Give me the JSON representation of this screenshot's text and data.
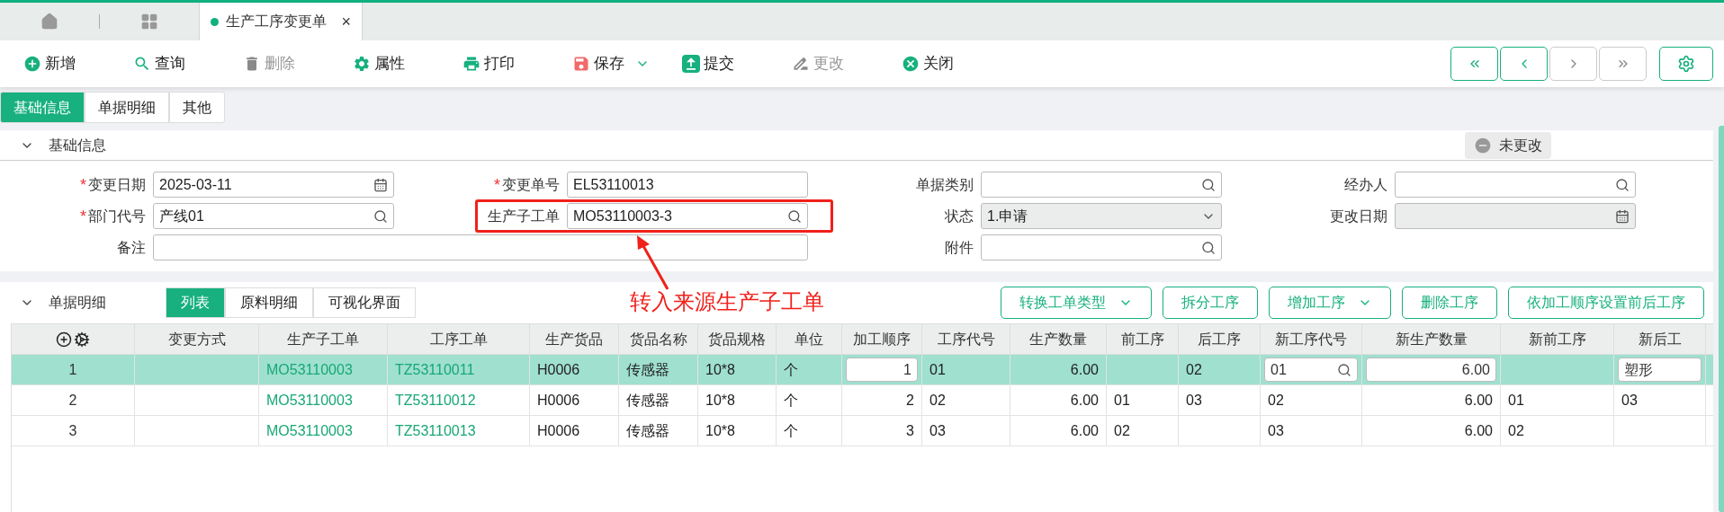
{
  "tab_bar": {
    "tabs": [
      {
        "label": "生产工序变更单",
        "selected": true,
        "close": "×"
      }
    ]
  },
  "toolbar": {
    "items": [
      {
        "label": "新增",
        "kind": "add",
        "disabled": false,
        "has_menu": false
      },
      {
        "label": "查询",
        "kind": "search",
        "disabled": false,
        "has_menu": false
      },
      {
        "label": "删除",
        "kind": "delete",
        "disabled": true,
        "has_menu": false
      },
      {
        "label": "属性",
        "kind": "settings",
        "disabled": false,
        "has_menu": false
      },
      {
        "label": "打印",
        "kind": "print",
        "disabled": false,
        "has_menu": false
      },
      {
        "label": "保存",
        "kind": "save",
        "disabled": false,
        "has_menu": true
      },
      {
        "label": "提交",
        "kind": "submit",
        "disabled": false,
        "has_menu": false
      },
      {
        "label": "更改",
        "kind": "edit",
        "disabled": true,
        "has_menu": false
      },
      {
        "label": "关闭",
        "kind": "close",
        "disabled": false,
        "has_menu": false
      }
    ],
    "nav": [
      {
        "kind": "first",
        "disabled": false
      },
      {
        "kind": "prev",
        "disabled": false
      },
      {
        "kind": "next",
        "disabled": true
      },
      {
        "kind": "last",
        "disabled": true
      }
    ]
  },
  "page_tabs": [
    {
      "label": "基础信息",
      "selected": true
    },
    {
      "label": "单据明细",
      "selected": false
    },
    {
      "label": "其他",
      "selected": false
    }
  ],
  "basic_section": {
    "title": "基础信息",
    "expanded": true,
    "status_badge": "未更改",
    "fields": [
      {
        "label": "变更日期",
        "marker": "*",
        "value": "2025-03-11",
        "kind": "date",
        "disabled": false,
        "highlighted": false,
        "wide": false
      },
      {
        "label": "变更单号",
        "marker": "*",
        "value": "EL53110013",
        "kind": "text",
        "disabled": false,
        "highlighted": false,
        "wide": false
      },
      {
        "label": "单据类别",
        "kind": "lookup",
        "disabled": false,
        "highlighted": false,
        "wide": false
      },
      {
        "label": "经办人",
        "kind": "lookup",
        "disabled": false,
        "highlighted": false,
        "wide": false
      },
      {
        "label": "部门代号",
        "marker": "*",
        "value": "产线01",
        "kind": "lookup",
        "disabled": false,
        "highlighted": false,
        "wide": false
      },
      {
        "label": "生产子工单",
        "value": "MO53110003-3",
        "kind": "lookup",
        "disabled": false,
        "highlighted": true,
        "wide": false
      },
      {
        "label": "状态",
        "value": "1.申请",
        "kind": "select",
        "disabled": true,
        "highlighted": false,
        "wide": false
      },
      {
        "label": "更改日期",
        "kind": "date",
        "disabled": true,
        "highlighted": false,
        "wide": false
      },
      {
        "label": "备注",
        "kind": "text",
        "disabled": false,
        "highlighted": false,
        "wide": true
      },
      {
        "label": "附件",
        "kind": "lookup",
        "disabled": false,
        "highlighted": false,
        "wide": false
      }
    ]
  },
  "annotation": {
    "text": "转入来源生产子工单"
  },
  "detail_section": {
    "title": "单据明细",
    "expanded": true,
    "view_tabs": [
      {
        "label": "列表",
        "selected": true
      },
      {
        "label": "原料明细",
        "selected": false
      },
      {
        "label": "可视化界面",
        "selected": false
      }
    ],
    "actions": [
      {
        "label": "转换工单类型",
        "has_menu": true
      },
      {
        "label": "拆分工序",
        "has_menu": false
      },
      {
        "label": "增加工序",
        "has_menu": true
      },
      {
        "label": "删除工序",
        "has_menu": false
      },
      {
        "label": "依加工顺序设置前后工序",
        "has_menu": false
      }
    ],
    "table": {
      "columns": [
        {
          "label": "变更方式",
          "kind": "text",
          "editable": false
        },
        {
          "label": "生产子工单",
          "kind": "link",
          "editable": false
        },
        {
          "label": "工序工单",
          "kind": "link",
          "editable": false
        },
        {
          "label": "生产货品",
          "kind": "text",
          "editable": false
        },
        {
          "label": "货品名称",
          "kind": "text",
          "editable": false
        },
        {
          "label": "货品规格",
          "kind": "text",
          "editable": false
        },
        {
          "label": "单位",
          "kind": "text",
          "editable": false
        },
        {
          "label": "加工顺序",
          "kind": "number",
          "editable": true,
          "lookup": false
        },
        {
          "label": "工序代号",
          "kind": "text",
          "editable": false
        },
        {
          "label": "生产数量",
          "kind": "number",
          "editable": false
        },
        {
          "label": "前工序",
          "kind": "text",
          "editable": false
        },
        {
          "label": "后工序",
          "kind": "text",
          "editable": false
        },
        {
          "label": "新工序代号",
          "kind": "text",
          "editable": true,
          "lookup": true
        },
        {
          "label": "新生产数量",
          "kind": "number",
          "editable": true,
          "lookup": false
        },
        {
          "label": "新前工序",
          "kind": "text",
          "editable": false
        },
        {
          "label": "新后工",
          "kind": "text",
          "editable": true,
          "lookup": false
        }
      ],
      "rows": [
        {
          "index": "1",
          "selected": true,
          "cells": [
            null,
            "MO53110003",
            "TZ53110011",
            "H0006",
            "传感器",
            "10*8",
            "个",
            "1",
            "01",
            "6.00",
            null,
            "02",
            "01",
            "6.00",
            null,
            "塑形"
          ]
        },
        {
          "index": "2",
          "selected": false,
          "cells": [
            null,
            "MO53110003",
            "TZ53110012",
            "H0006",
            "传感器",
            "10*8",
            "个",
            "2",
            "02",
            "6.00",
            "01",
            "03",
            "02",
            "6.00",
            "01",
            "03"
          ]
        },
        {
          "index": "3",
          "selected": false,
          "cells": [
            null,
            "MO53110003",
            "TZ53110013",
            "H0006",
            "传感器",
            "10*8",
            "个",
            "3",
            "03",
            "6.00",
            "02",
            null,
            "03",
            "6.00",
            "02",
            null
          ]
        }
      ]
    }
  }
}
